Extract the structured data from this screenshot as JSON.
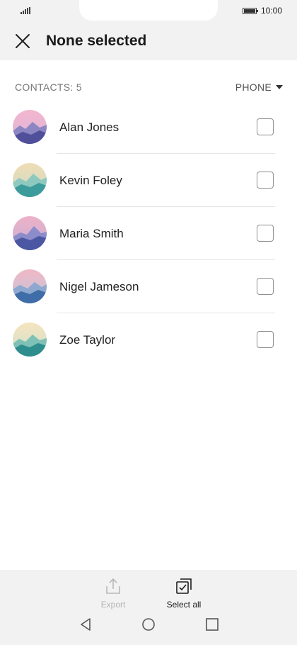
{
  "status_bar": {
    "time": "10:00",
    "icons": [
      "signal-icon",
      "battery-icon"
    ]
  },
  "header": {
    "title": "None selected",
    "close_icon": "close-icon"
  },
  "list_header": {
    "count_label": "CONTACTS: 5",
    "filter_label": "PHONE"
  },
  "contacts": [
    {
      "name": "Alan Jones",
      "checked": false
    },
    {
      "name": "Kevin Foley",
      "checked": false
    },
    {
      "name": "Maria Smith",
      "checked": false
    },
    {
      "name": "Nigel Jameson",
      "checked": false
    },
    {
      "name": "Zoe Taylor",
      "checked": false
    }
  ],
  "bottom_bar": {
    "export_label": "Export",
    "select_all_label": "Select all"
  },
  "nav": {
    "icons": [
      "back-icon",
      "home-icon",
      "recent-apps-icon"
    ]
  },
  "colors": {
    "bar_background": "#f2f2f2",
    "disabled_text": "#b3b3b3",
    "divider": "#e6e6e6"
  }
}
